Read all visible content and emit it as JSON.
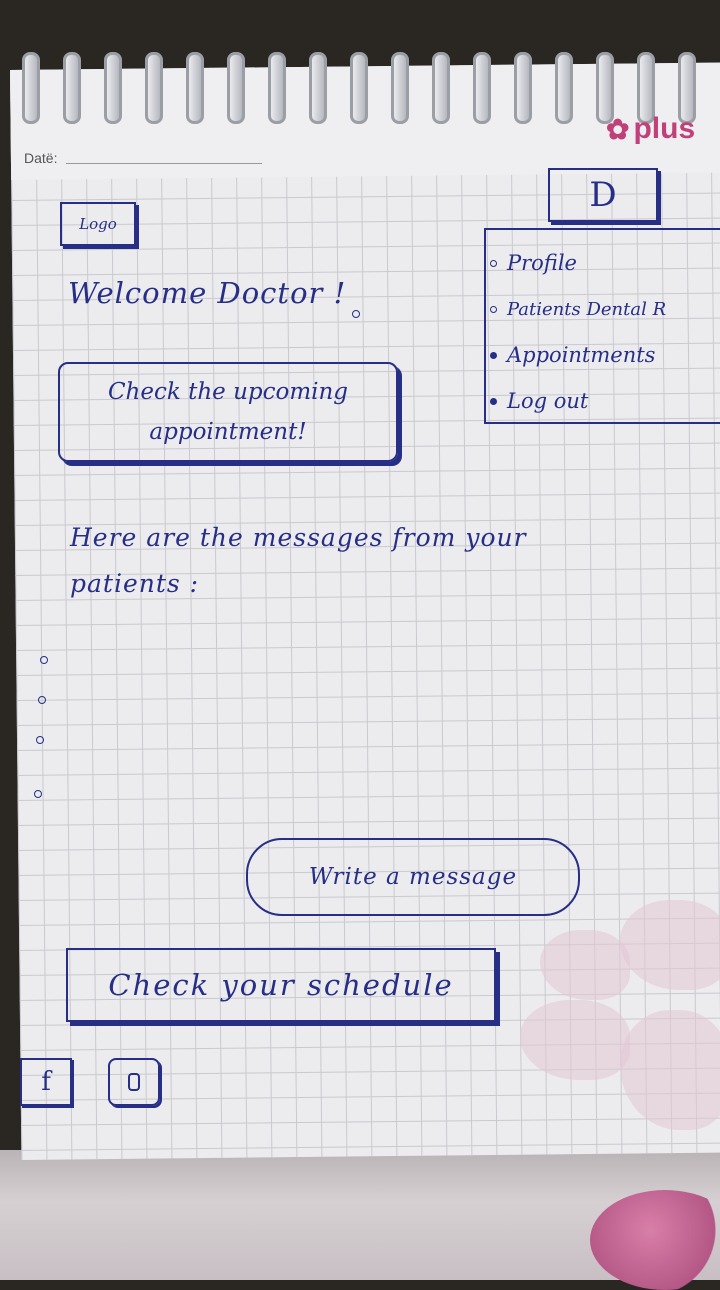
{
  "notebook": {
    "brand": "plus",
    "date_label": "Datë:"
  },
  "header": {
    "logo_label": "Logo",
    "profile_button_label": "D"
  },
  "menu": {
    "items": [
      {
        "label": "Profile",
        "bullet": "hollow"
      },
      {
        "label": "Patients Dental R",
        "bullet": "hollow"
      },
      {
        "label": "Appointments",
        "bullet": "filled"
      },
      {
        "label": "Log out",
        "bullet": "filled"
      }
    ]
  },
  "main": {
    "welcome_text": "Welcome Doctor !",
    "upcoming_button_label": "Check the upcoming appointment!",
    "messages_heading": "Here are the messages from your patients :",
    "message_items": [
      "",
      "",
      "",
      ""
    ],
    "write_button_label": "Write a message",
    "schedule_button_label": "Check your schedule"
  },
  "footer": {
    "facebook_icon": "facebook-icon",
    "instagram_icon": "instagram-icon",
    "facebook_glyph": "f"
  },
  "colors": {
    "ink": "#262e86",
    "brand": "#c0407a",
    "paper": "#ecebee",
    "grid": "#c9c9cf"
  }
}
